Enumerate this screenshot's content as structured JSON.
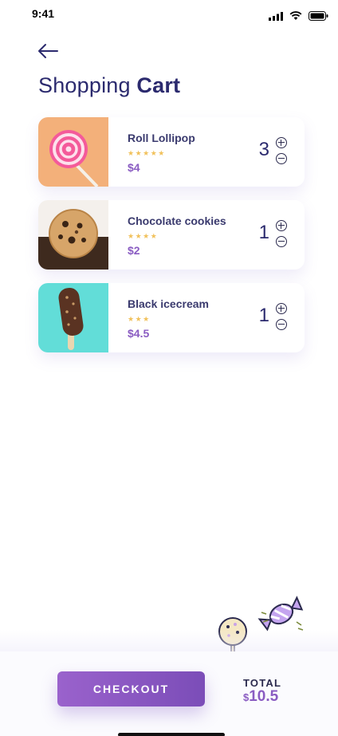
{
  "status_bar": {
    "time": "9:41"
  },
  "header": {
    "title_light": "Shopping",
    "title_bold": "Cart"
  },
  "cart": [
    {
      "name": "Roll Lollipop",
      "stars": "★★★★★",
      "price": "$4",
      "qty": "3"
    },
    {
      "name": "Chocolate cookies",
      "stars": "★★★★",
      "price": "$2",
      "qty": "1"
    },
    {
      "name": "Black icecream",
      "stars": "★★★",
      "price": "$4.5",
      "qty": "1"
    }
  ],
  "footer": {
    "checkout_label": "CHECKOUT",
    "total_label": "TOTAL",
    "currency": "$",
    "total_value": "10.5"
  },
  "colors": {
    "title": "#2b2a6e",
    "accent": "#8a5cc2",
    "stars": "#f1c15b",
    "checkout": "#8a56c2"
  }
}
